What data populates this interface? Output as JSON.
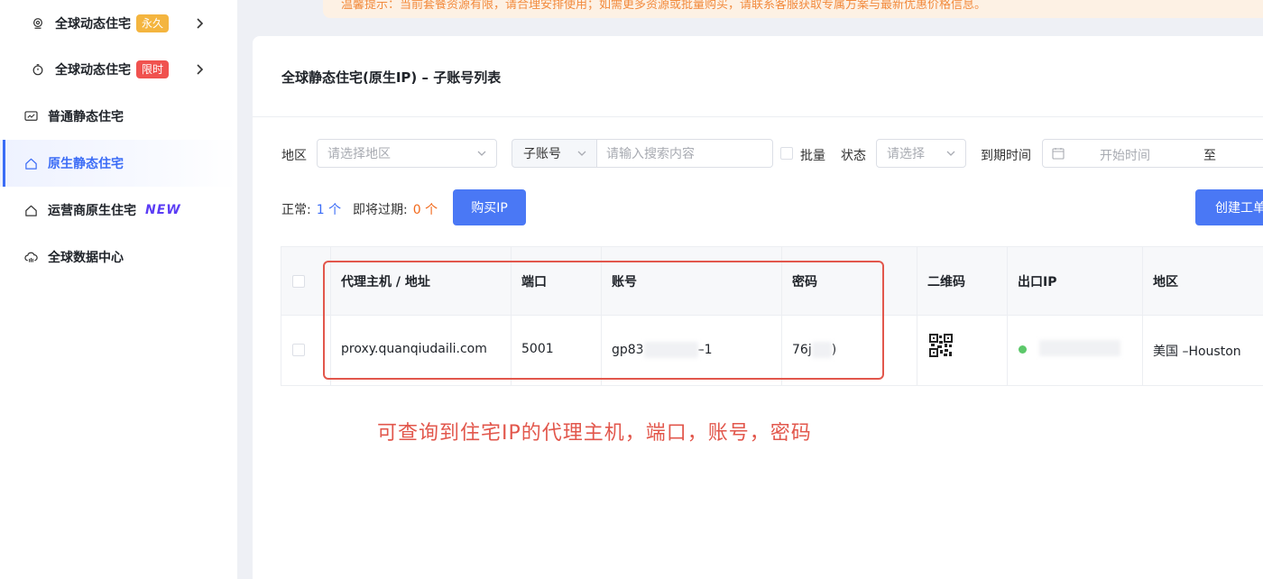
{
  "notice": {
    "text": "温馨提示：当前套餐资源有限，请合理安排使用；如需更多资源或批量购买，请联系客服获取专属方案与最新优惠价格信息。"
  },
  "sidebar": {
    "items": [
      {
        "label": "全球动态住宅",
        "badge": "永久",
        "icon": "location-pin-icon"
      },
      {
        "label": "全球动态住宅",
        "badge": "限时",
        "icon": "timer-icon"
      },
      {
        "label": "普通静态住宅",
        "icon": "monitor-icon"
      },
      {
        "label": "原生静态住宅",
        "icon": "home-icon"
      },
      {
        "label": "运营商原生住宅",
        "badge": "NEW",
        "icon": "home-icon"
      },
      {
        "label": "全球数据中心",
        "icon": "cloud-icon"
      }
    ]
  },
  "page": {
    "title": "全球静态住宅(原生IP) – 子账号列表"
  },
  "filters": {
    "region_label": "地区",
    "region_placeholder": "请选择地区",
    "search_type": "子账号",
    "search_placeholder": "请输入搜索内容",
    "batch_label": "批量",
    "status_label": "状态",
    "status_placeholder": "请选择",
    "expire_label": "到期时间",
    "start_placeholder": "开始时间",
    "range_separator": "至"
  },
  "stats": {
    "normal_label": "正常:",
    "normal_value": "1 个",
    "expiring_label": "即将过期:",
    "expiring_value": "0 个"
  },
  "buttons": {
    "buy_ip": "购买IP",
    "create_ticket": "创建工单"
  },
  "table": {
    "headers": [
      "代理主机 / 地址",
      "端口",
      "账号",
      "密码",
      "二维码",
      "出口IP",
      "地区"
    ],
    "rows": [
      {
        "host": "proxy.quanqiudaili.com",
        "port": "5001",
        "account_prefix": "gp83",
        "account_suffix": "–1",
        "password_prefix": "76j",
        "password_suffix": ")",
        "region": "美国 –Houston",
        "status_color": "#5cc86a"
      }
    ]
  },
  "annotation": {
    "text": "可查询到住宅IP的代理主机，端口，账号，密码"
  }
}
